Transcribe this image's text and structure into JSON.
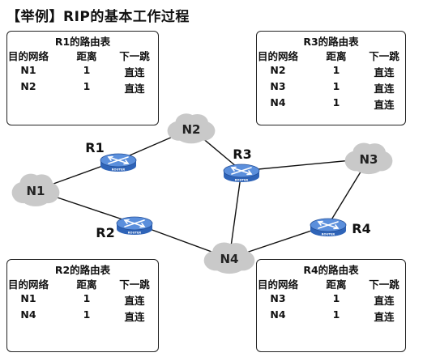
{
  "title": "【举例】RIP的基本工作过程",
  "routers": [
    {
      "id": "r1",
      "name": "R1",
      "badge": "ROUTER"
    },
    {
      "id": "r2",
      "name": "R2",
      "badge": "ROUTER"
    },
    {
      "id": "r3",
      "name": "R3",
      "badge": "ROUTER"
    },
    {
      "id": "r4",
      "name": "R4",
      "badge": "ROUTER"
    }
  ],
  "networks": [
    {
      "id": "n1",
      "name": "N1"
    },
    {
      "id": "n2",
      "name": "N2"
    },
    {
      "id": "n3",
      "name": "N3"
    },
    {
      "id": "n4",
      "name": "N4"
    }
  ],
  "links": [
    [
      "r1",
      "n1"
    ],
    [
      "r1",
      "n2"
    ],
    [
      "n2",
      "r3"
    ],
    [
      "r3",
      "n3"
    ],
    [
      "r3",
      "n4"
    ],
    [
      "n1",
      "r2"
    ],
    [
      "r2",
      "n4"
    ],
    [
      "n4",
      "r4"
    ],
    [
      "r4",
      "n3"
    ]
  ],
  "tables": [
    {
      "id": "r1",
      "caption": "R1的路由表",
      "headers": [
        "目的网络",
        "距离",
        "下一跳"
      ],
      "rows": [
        [
          "N1",
          "1",
          "直连"
        ],
        [
          "N2",
          "1",
          "直连"
        ]
      ]
    },
    {
      "id": "r3",
      "caption": "R3的路由表",
      "headers": [
        "目的网络",
        "距离",
        "下一跳"
      ],
      "rows": [
        [
          "N2",
          "1",
          "直连"
        ],
        [
          "N3",
          "1",
          "直连"
        ],
        [
          "N4",
          "1",
          "直连"
        ]
      ]
    },
    {
      "id": "r2",
      "caption": "R2的路由表",
      "headers": [
        "目的网络",
        "距离",
        "下一跳"
      ],
      "rows": [
        [
          "N1",
          "1",
          "直连"
        ],
        [
          "N4",
          "1",
          "直连"
        ]
      ]
    },
    {
      "id": "r4",
      "caption": "R4的路由表",
      "headers": [
        "目的网络",
        "距离",
        "下一跳"
      ],
      "rows": [
        [
          "N3",
          "1",
          "直连"
        ],
        [
          "N4",
          "1",
          "直连"
        ]
      ]
    }
  ],
  "colors": {
    "router_body": "#2f64b8",
    "router_top": "#5b8fdc",
    "cloud": "#c9c9c9",
    "link": "#111111"
  }
}
